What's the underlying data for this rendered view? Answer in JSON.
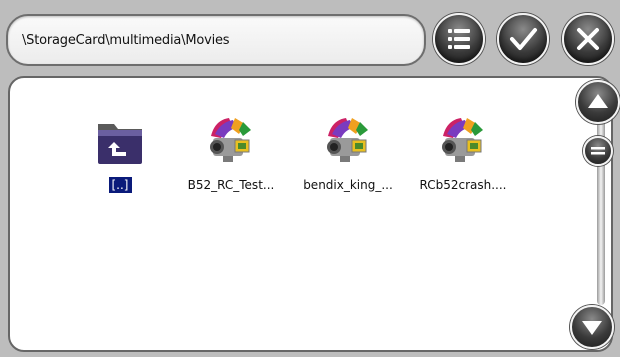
{
  "path_bar": {
    "path": "\\StorageCard\\multimedia\\Movies"
  },
  "toolbar": {
    "menu_icon": "list-icon",
    "ok_icon": "checkmark-icon",
    "close_icon": "close-icon"
  },
  "files": [
    {
      "label": "[..]",
      "icon": "parent-folder-icon",
      "selected": true
    },
    {
      "label": "B52_RC_Test...",
      "icon": "video-file-icon",
      "selected": false
    },
    {
      "label": "bendix_king_...",
      "icon": "video-file-icon",
      "selected": false
    },
    {
      "label": "RCb52crash....",
      "icon": "video-file-icon",
      "selected": false
    }
  ],
  "scrollbar": {
    "up_icon": "triangle-up-icon",
    "down_icon": "triangle-down-icon",
    "thumb_icon": "thumb-lines-icon"
  }
}
